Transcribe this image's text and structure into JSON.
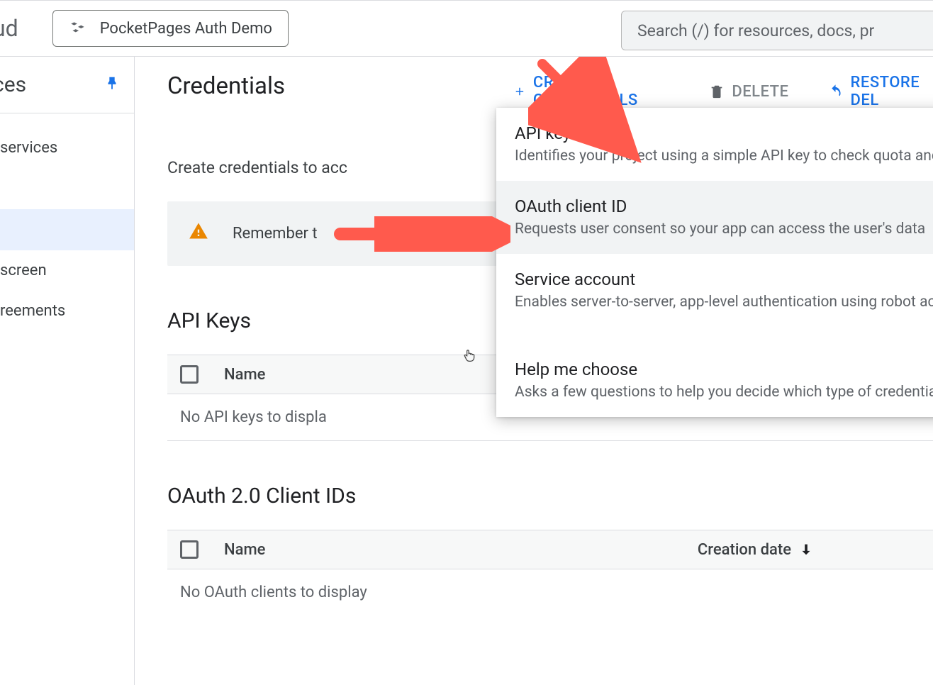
{
  "topbar": {
    "logo_tail": "ud",
    "project_name": "PocketPages Auth Demo",
    "search_placeholder": "Search (/) for resources, docs, pr"
  },
  "sidebar": {
    "title_tail": "ces",
    "items": [
      {
        "label": "services"
      },
      {
        "label": ""
      },
      {
        "label": "screen"
      },
      {
        "label": "reements"
      }
    ]
  },
  "page": {
    "title": "Credentials",
    "intro": "Create credentials to acc",
    "banner": "Remember t"
  },
  "toolbar": {
    "create": "CREATE CREDENTIALS",
    "delete": "DELETE",
    "restore": "RESTORE DEL"
  },
  "dropdown": {
    "items": [
      {
        "title": "API key",
        "desc": "Identifies your project using a simple API key to check quota and ac"
      },
      {
        "title": "OAuth client ID",
        "desc": "Requests user consent so your app can access the user's data"
      },
      {
        "title": "Service account",
        "desc": "Enables server-to-server, app-level authentication using robot accou"
      },
      {
        "title": "Help me choose",
        "desc": "Asks a few questions to help you decide which type of credential to"
      }
    ]
  },
  "sections": {
    "api_keys": {
      "title": "API Keys",
      "col_name": "Name",
      "empty": "No API keys to displa"
    },
    "oauth": {
      "title": "OAuth 2.0 Client IDs",
      "col_name": "Name",
      "col_creation": "Creation date",
      "empty": "No OAuth clients to display"
    }
  }
}
